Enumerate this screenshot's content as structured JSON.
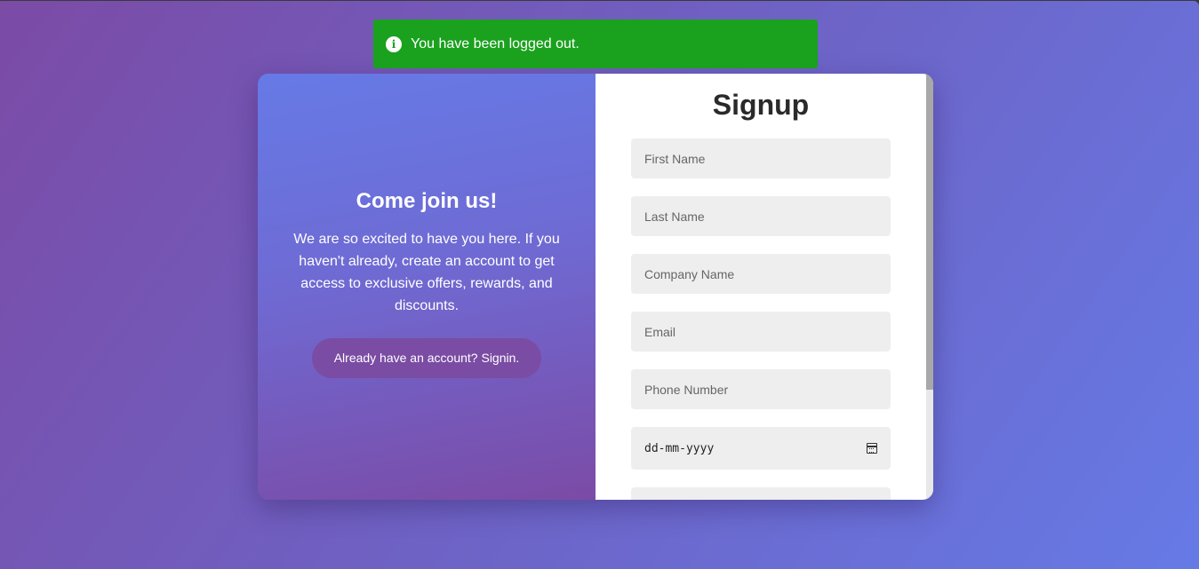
{
  "toast": {
    "message": "You have been logged out.",
    "icon": "info-icon",
    "color": "#1aa11e"
  },
  "welcome": {
    "title": "Come join us!",
    "text": "We are so excited to have you here. If you haven't already, create an account to get access to exclusive offers, rewards, and discounts.",
    "signin_label": "Already have an account? Signin."
  },
  "signup": {
    "title": "Signup",
    "fields": {
      "first_name": "First Name",
      "last_name": "Last Name",
      "company_name": "Company Name",
      "email": "Email",
      "phone": "Phone Number",
      "date": "dd-mm-yyyy"
    }
  }
}
